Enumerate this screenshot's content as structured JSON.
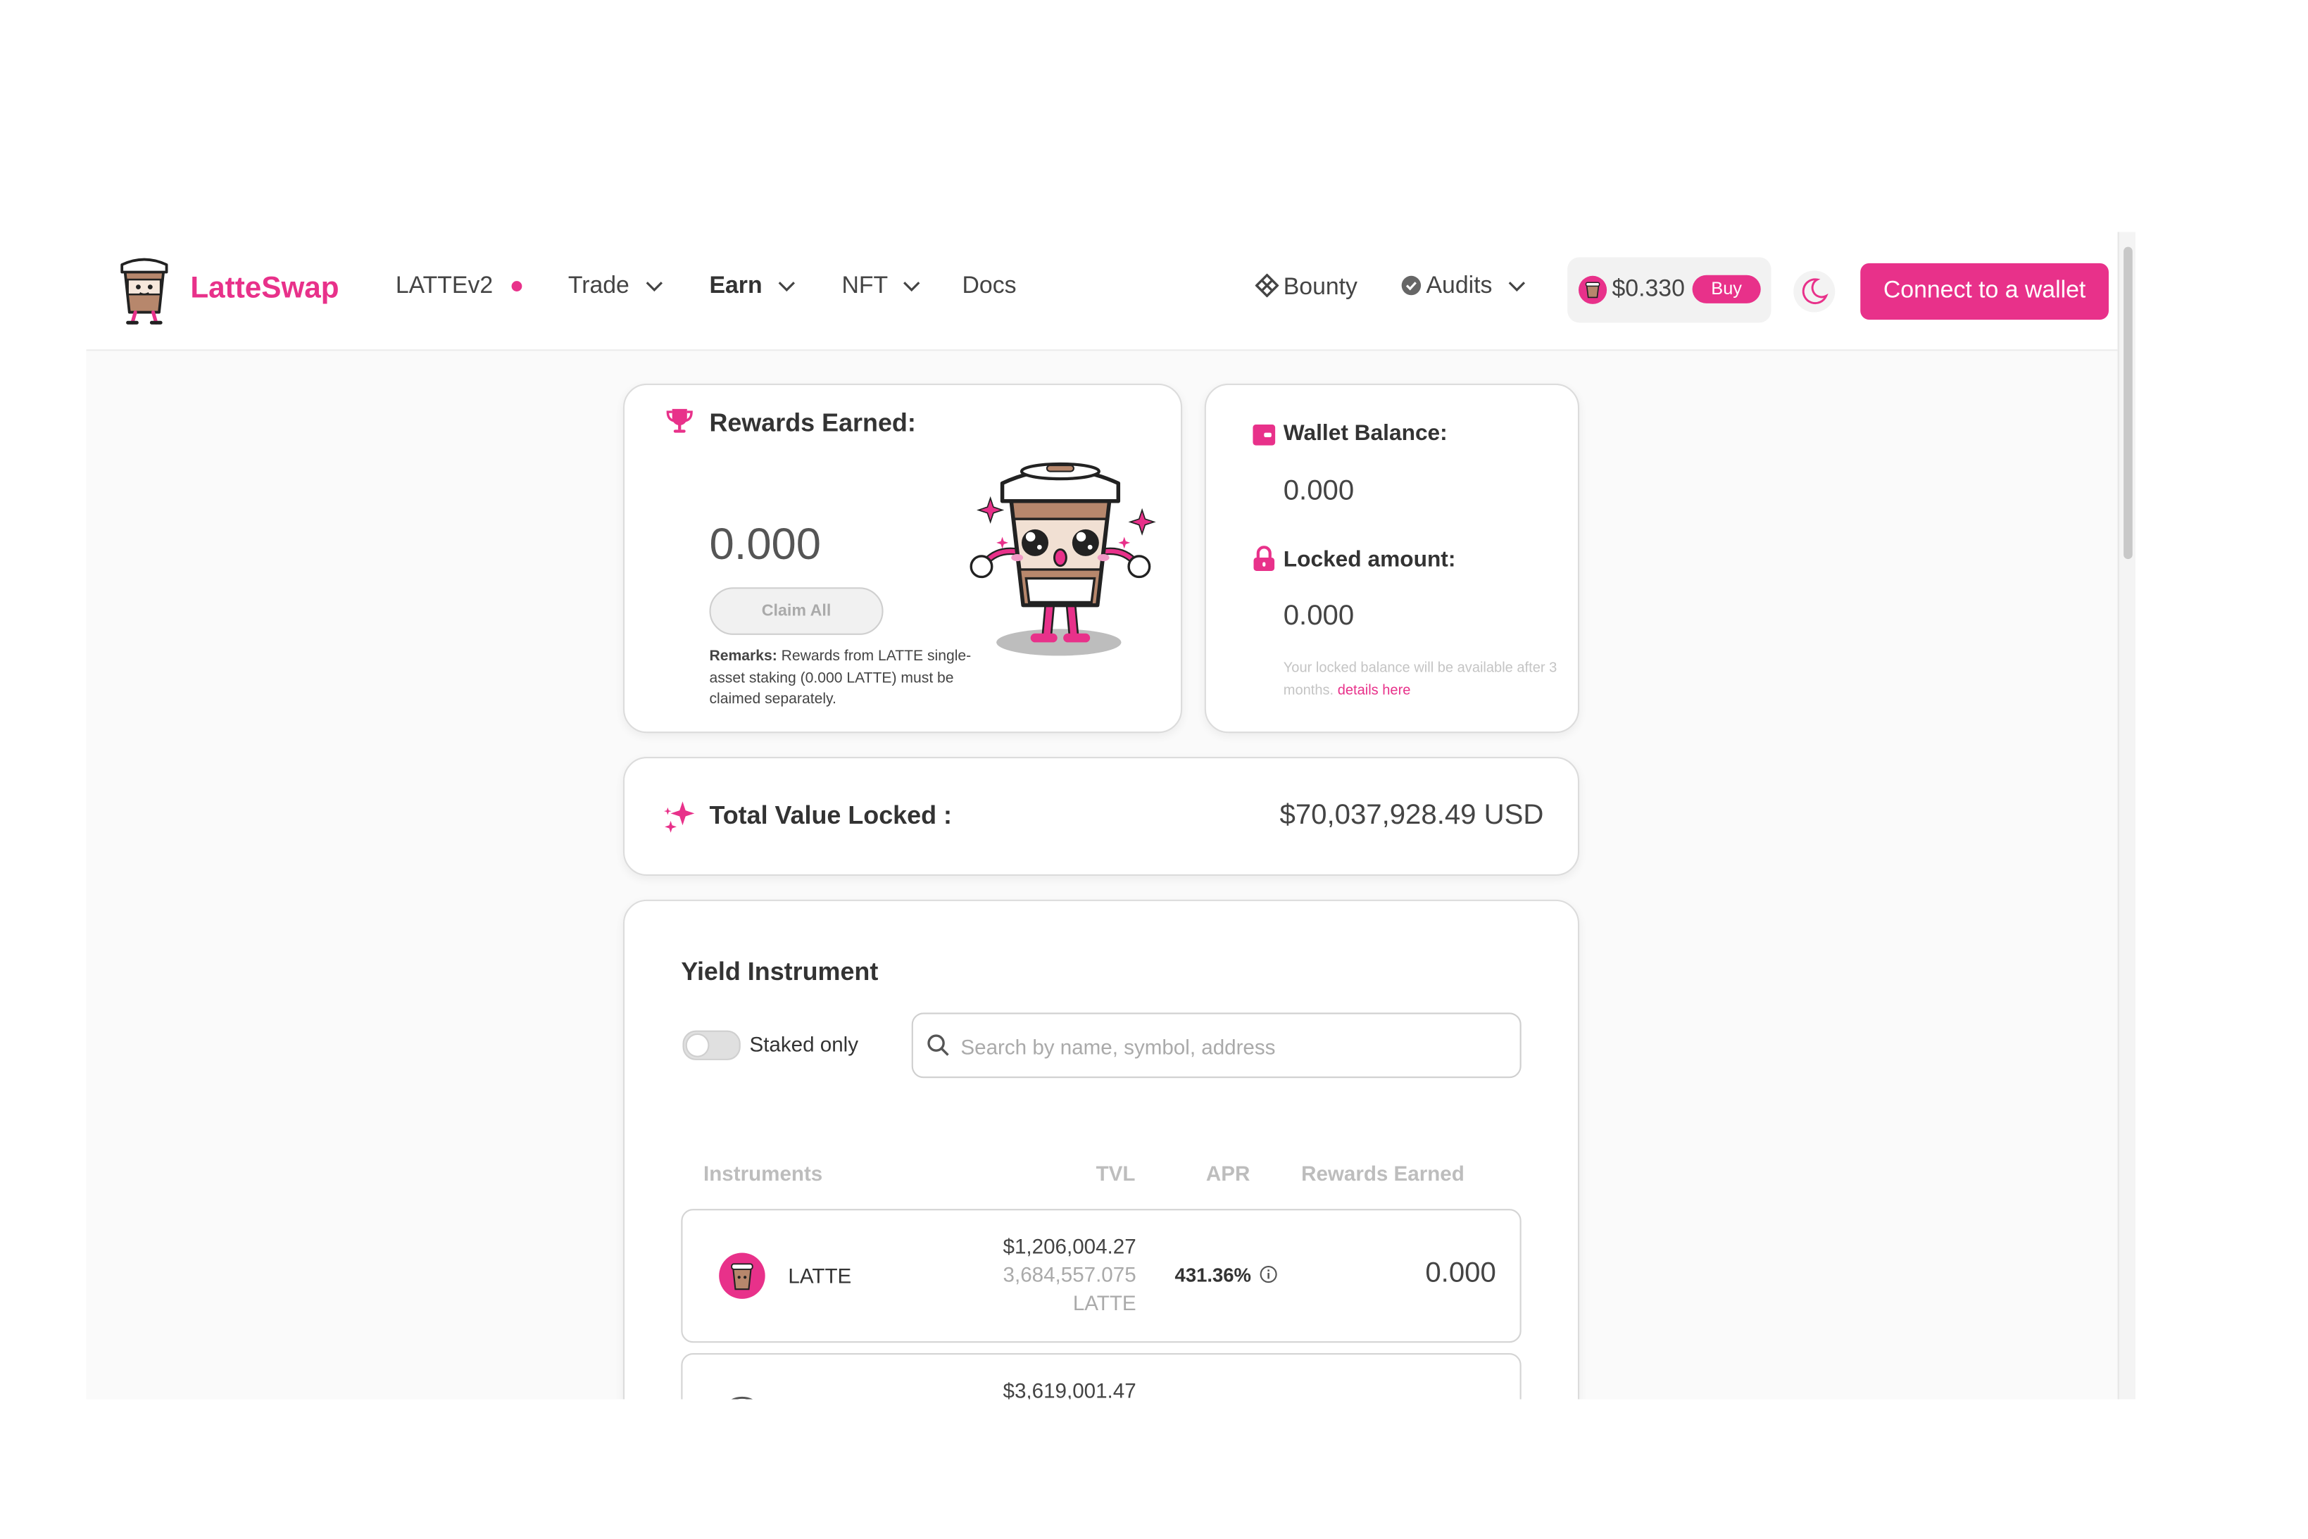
{
  "header": {
    "brand_name": "LatteSwap",
    "nav": {
      "lattev2": "LATTEv2",
      "trade": "Trade",
      "earn": "Earn",
      "nft": "NFT",
      "docs": "Docs",
      "bounty": "Bounty",
      "audits": "Audits"
    },
    "price": "$0.330",
    "buy_label": "Buy",
    "connect_label": "Connect to a wallet"
  },
  "rewards_card": {
    "title": "Rewards Earned:",
    "value": "0.000",
    "claim_label": "Claim All",
    "remarks_label": "Remarks:",
    "remarks_text": " Rewards from LATTE single-asset staking (0.000 LATTE) must be claimed separately."
  },
  "wallet_card": {
    "balance_title": "Wallet Balance:",
    "balance_value": "0.000",
    "locked_title": "Locked amount:",
    "locked_value": "0.000",
    "note_text": "Your locked balance will be available after 3 months.",
    "note_link": "details here"
  },
  "tvl_card": {
    "title": "Total Value Locked :",
    "value": "$70,037,928.49 USD"
  },
  "yield": {
    "title": "Yield Instrument",
    "staked_only_label": "Staked only",
    "search_placeholder": "Search by name, symbol, address",
    "columns": {
      "instruments": "Instruments",
      "tvl": "TVL",
      "apr": "APR",
      "rewards": "Rewards Earned"
    },
    "rows": [
      {
        "name": "LATTE",
        "tvl_usd": "$1,206,004.27",
        "tvl_amount": "3,684,557.075",
        "tvl_unit": "LATTE",
        "apr": "431.36%",
        "rewards": "0.000"
      },
      {
        "tvl_usd": "$3,619,001.47"
      }
    ]
  },
  "colors": {
    "brand_pink": "#e8318a",
    "latte_brown": "#b7876c",
    "card_border": "#dcdcdc"
  },
  "icons": {
    "logo": "latte-cup-mascot",
    "trophy": "trophy-icon",
    "wallet": "wallet-icon",
    "lock": "lock-icon",
    "sparkle": "sparkle-icon",
    "search": "search-icon",
    "bounty": "bounty-icon",
    "audits": "shield-check-icon",
    "theme": "moon-icon",
    "info": "info-icon"
  }
}
